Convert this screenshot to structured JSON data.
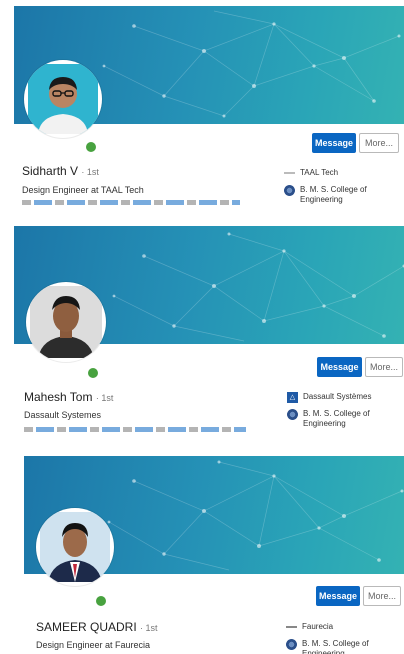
{
  "profiles": [
    {
      "name": "Sidharth V",
      "degree": "· 1st",
      "headline": "Design Engineer at TAAL Tech",
      "company": "TAAL Tech",
      "company_logo": "taal-logo",
      "education": "B. M. S. College of Engineering",
      "message_label": "Message",
      "more_label": "More...",
      "online": true
    },
    {
      "name": "Mahesh Tom",
      "degree": "· 1st",
      "headline": "Dassault Systemes",
      "company": "Dassault Systèmes",
      "company_logo": "dassault-logo",
      "education": "B. M. S. College of Engineering",
      "message_label": "Message",
      "more_label": "More...",
      "online": true
    },
    {
      "name": "SAMEER QUADRI",
      "degree": "· 1st",
      "headline": "Design Engineer at Faurecia",
      "company": "Faurecia",
      "company_logo": "faurecia-logo",
      "education": "B. M. S. College of Engineering",
      "message_label": "Message",
      "more_label": "More...",
      "online": true
    }
  ],
  "colors": {
    "banner_start": "#1c76a8",
    "banner_end": "#34b2b3",
    "message_button": "#0a66c2",
    "online_dot": "#48a23f"
  }
}
